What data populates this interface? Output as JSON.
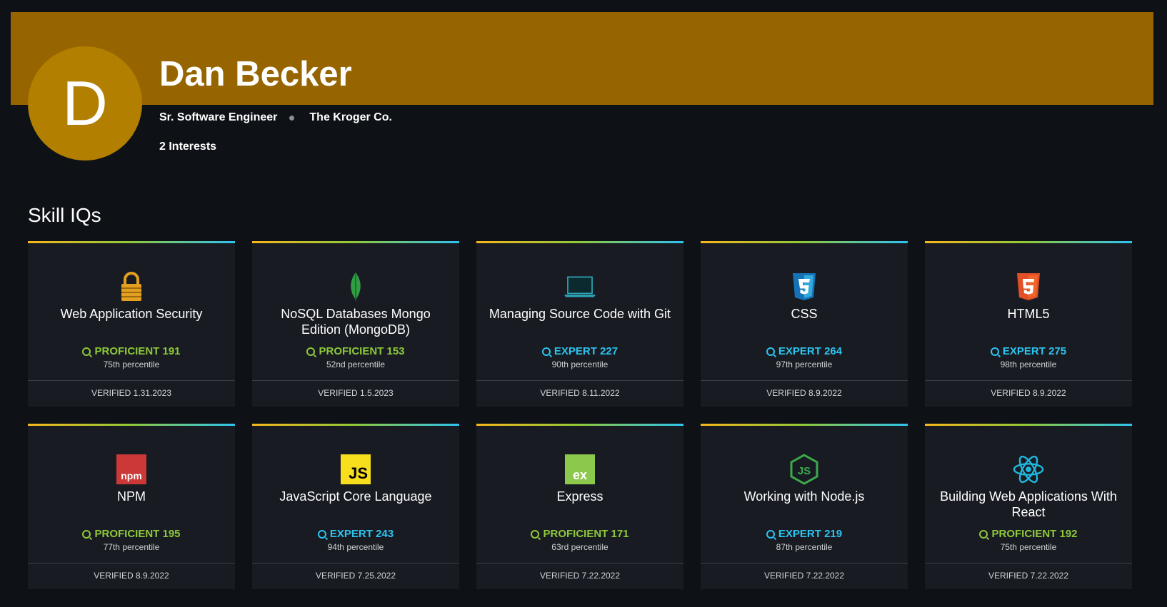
{
  "profile": {
    "avatar_letter": "D",
    "name": "Dan Becker",
    "role": "Sr. Software Engineer",
    "company": "The Kroger Co.",
    "interests": "2 Interests",
    "banner_color": "#966500",
    "avatar_color": "#b27f00"
  },
  "section": {
    "title": "Skill IQs"
  },
  "colors": {
    "proficient": "#8fc93a",
    "expert": "#2ec4f1",
    "gradient": [
      "#f7b718",
      "#8fc93a",
      "#2ec4f1"
    ]
  },
  "skills": [
    {
      "icon": "lock-icon",
      "title": "Web Application Security",
      "level": "PROFICIENT 191",
      "kind": "proficient",
      "percentile": "75th percentile",
      "verified": "VERIFIED 1.31.2023"
    },
    {
      "icon": "mongodb-leaf-icon",
      "title": "NoSQL Databases Mongo Edition (MongoDB)",
      "level": "PROFICIENT 153",
      "kind": "proficient",
      "percentile": "52nd percentile",
      "verified": "VERIFIED 1.5.2023"
    },
    {
      "icon": "laptop-icon",
      "title": "Managing Source Code with Git",
      "level": "EXPERT 227",
      "kind": "expert",
      "percentile": "90th percentile",
      "verified": "VERIFIED 8.11.2022"
    },
    {
      "icon": "css3-icon",
      "title": "CSS",
      "level": "EXPERT 264",
      "kind": "expert",
      "percentile": "97th percentile",
      "verified": "VERIFIED 8.9.2022"
    },
    {
      "icon": "html5-icon",
      "title": "HTML5",
      "level": "EXPERT 275",
      "kind": "expert",
      "percentile": "98th percentile",
      "verified": "VERIFIED 8.9.2022"
    },
    {
      "icon": "npm-icon",
      "icon_text": "npm",
      "title": "NPM",
      "level": "PROFICIENT 195",
      "kind": "proficient",
      "percentile": "77th percentile",
      "verified": "VERIFIED 8.9.2022"
    },
    {
      "icon": "javascript-icon",
      "icon_text": "JS",
      "title": "JavaScript Core Language",
      "level": "EXPERT 243",
      "kind": "expert",
      "percentile": "94th percentile",
      "verified": "VERIFIED 7.25.2022"
    },
    {
      "icon": "express-icon",
      "icon_text": "ex",
      "title": "Express",
      "level": "PROFICIENT 171",
      "kind": "proficient",
      "percentile": "63rd percentile",
      "verified": "VERIFIED 7.22.2022"
    },
    {
      "icon": "nodejs-icon",
      "title": "Working with Node.js",
      "level": "EXPERT 219",
      "kind": "expert",
      "percentile": "87th percentile",
      "verified": "VERIFIED 7.22.2022"
    },
    {
      "icon": "react-icon",
      "title": "Building Web Applications With React",
      "level": "PROFICIENT 192",
      "kind": "proficient",
      "percentile": "75th percentile",
      "verified": "VERIFIED 7.22.2022"
    }
  ]
}
